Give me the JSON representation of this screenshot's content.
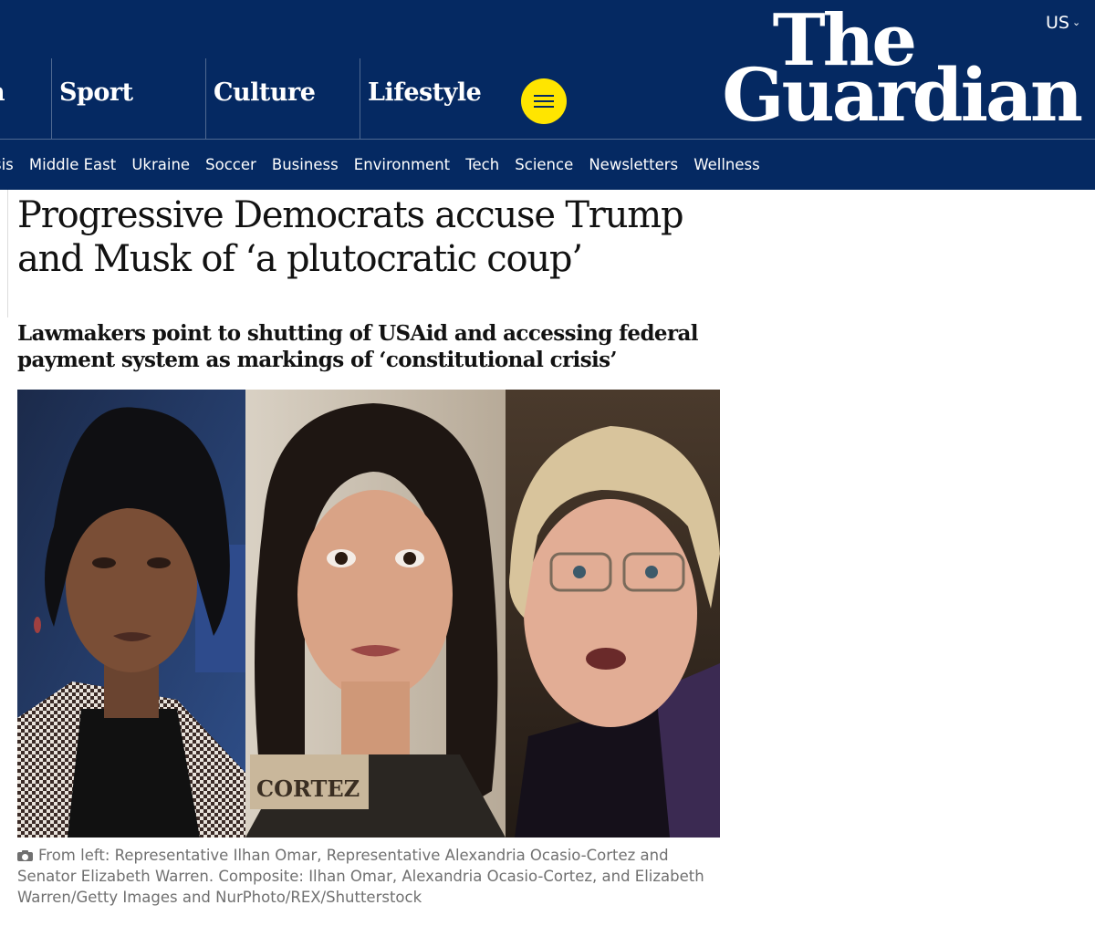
{
  "header": {
    "edition": "US",
    "logo": {
      "line1": "The",
      "line2": "Guardian"
    },
    "pillars": [
      {
        "label": "n"
      },
      {
        "label": "Sport"
      },
      {
        "label": "Culture"
      },
      {
        "label": "Lifestyle"
      }
    ],
    "colors": {
      "brand": "#052962",
      "menu_button": "#ffe500",
      "divider": "#506991"
    }
  },
  "subnav": {
    "items": [
      "sis",
      "Middle East",
      "Ukraine",
      "Soccer",
      "Business",
      "Environment",
      "Tech",
      "Science",
      "Newsletters",
      "Wellness"
    ]
  },
  "article": {
    "headline": "Progressive Democrats accuse Trump and Musk of ‘a plutocratic coup’",
    "standfirst": "Lawmakers point to shutting of USAid and accessing federal payment system as markings of ‘constitutional crisis’",
    "image": {
      "nameplate_text": "CORTEZ"
    },
    "caption": "From left: Representative Ilhan Omar, Representative Alexandria Ocasio-Cortez and Senator Elizabeth Warren. Composite: Ilhan Omar, Alexandria Ocasio-Cortez, and Elizabeth Warren/Getty Images and NurPhoto/REX/Shutterstock"
  }
}
